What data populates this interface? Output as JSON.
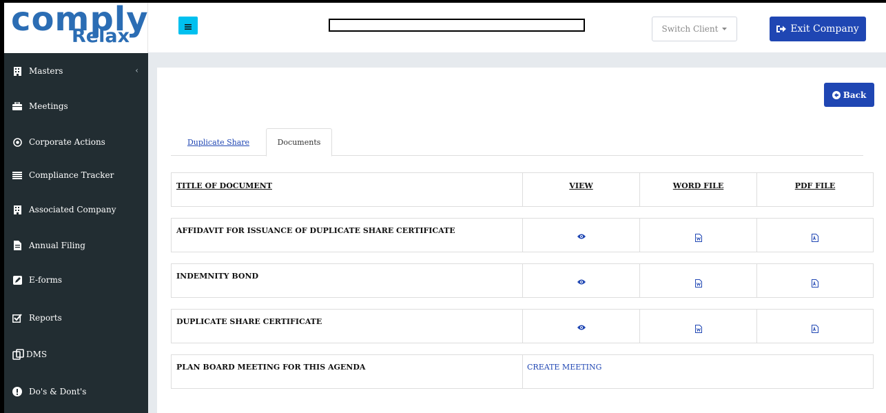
{
  "logo": {
    "top": "comply",
    "bottom": "Relax"
  },
  "sidebar": {
    "items": [
      {
        "label": "Masters",
        "icon": "building-icon"
      },
      {
        "label": "Meetings",
        "icon": "briefcase-icon"
      },
      {
        "label": "Corporate Actions",
        "icon": "target-icon"
      },
      {
        "label": "Compliance Tracker",
        "icon": "list-icon"
      },
      {
        "label": "Associated Company",
        "icon": "building-icon"
      },
      {
        "label": "Annual Filing",
        "icon": "file-icon"
      },
      {
        "label": "E-forms",
        "icon": "edit-square-icon"
      },
      {
        "label": "Reports",
        "icon": "checkbox-icon"
      },
      {
        "label": "DMS",
        "icon": "copy-icon"
      },
      {
        "label": "Do's & Dont's",
        "icon": "exclamation-circle-icon"
      }
    ],
    "chevron": "‹"
  },
  "header": {
    "search_value": "",
    "switch_client": "Switch Client",
    "exit_company": "Exit Company"
  },
  "content": {
    "back": "Back",
    "tabs": [
      "Duplicate Share",
      "Documents"
    ],
    "table": {
      "headers": [
        "TITLE OF DOCUMENT",
        "VIEW",
        "WORD FILE",
        "PDF FILE"
      ],
      "rows": [
        "AFFIDAVIT FOR ISSUANCE OF DUPLICATE SHARE CERTIFICATE",
        "INDEMNITY BOND",
        "DUPLICATE SHARE CERTIFICATE"
      ],
      "footer_title": "PLAN BOARD MEETING FOR THIS AGENDA",
      "footer_link": "CREATE MEETING"
    }
  },
  "colors": {
    "sidebar_bg": "#222d32",
    "primary": "#1f46b3",
    "toggle": "#00c0ef",
    "logo": "#2b6db4"
  }
}
